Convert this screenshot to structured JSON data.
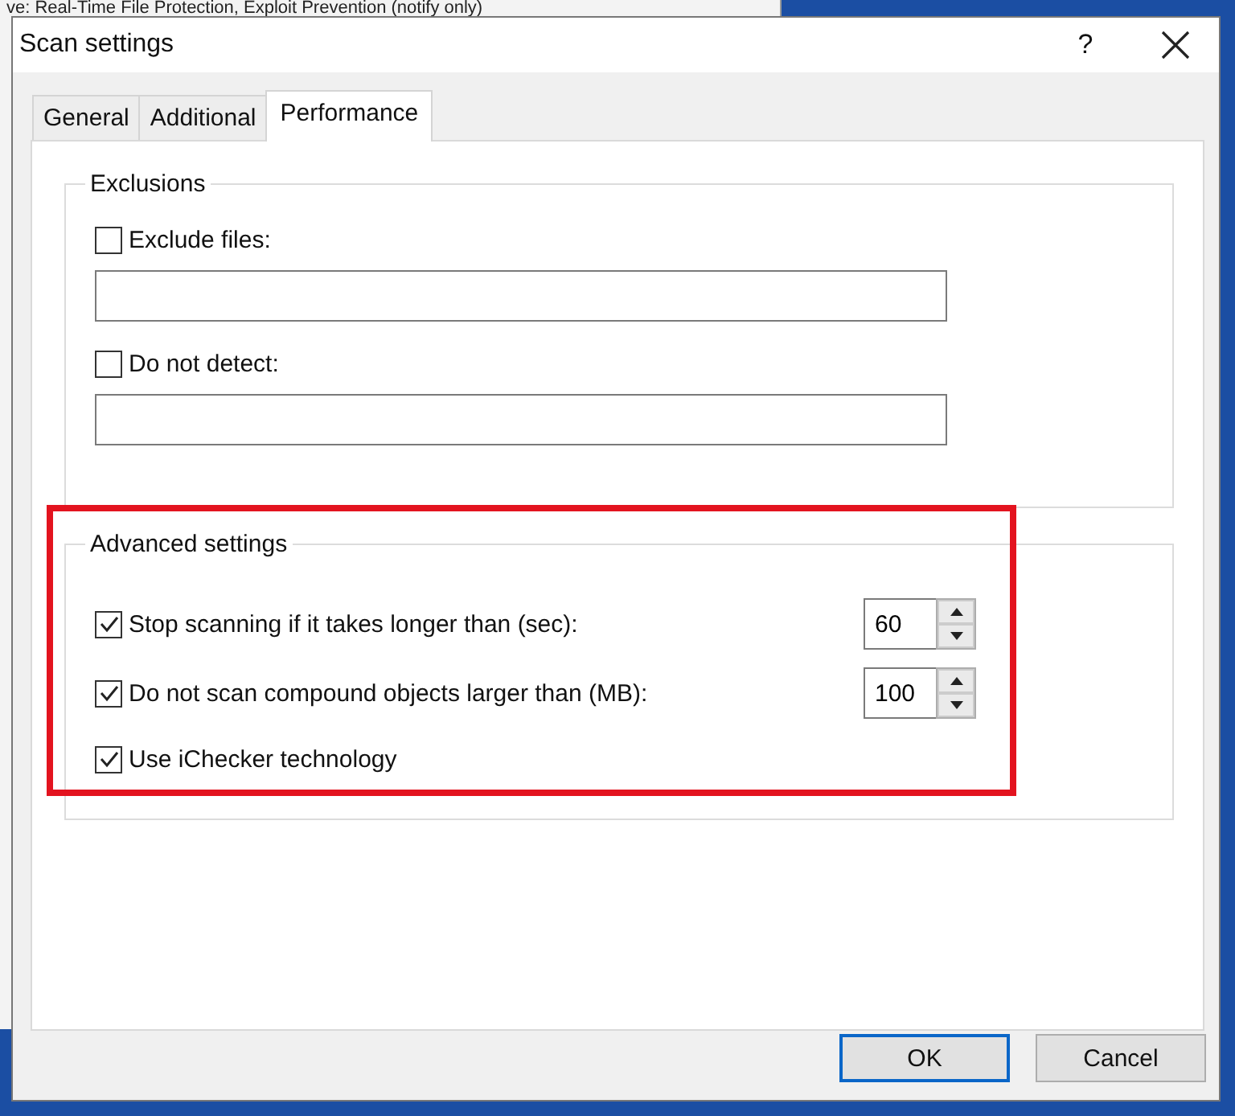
{
  "background_window": {
    "text": "ve: Real-Time File Protection, Exploit Prevention (notify only)"
  },
  "window": {
    "title": "Scan settings",
    "help": "?"
  },
  "tabs": [
    {
      "label": "General",
      "selected": false
    },
    {
      "label": "Additional",
      "selected": false
    },
    {
      "label": "Performance",
      "selected": true
    }
  ],
  "exclusions": {
    "title": "Exclusions",
    "items": [
      {
        "label": "Exclude files:",
        "checked": false
      },
      {
        "label": "Do not detect:",
        "checked": false
      }
    ]
  },
  "advanced": {
    "title": "Advanced settings",
    "highlighted": true,
    "items": [
      {
        "kind": "spin",
        "label": "Stop scanning if it takes longer than (sec):",
        "checked": true,
        "value": "60"
      },
      {
        "kind": "spin",
        "label": "Do not scan compound objects larger than (MB):",
        "checked": true,
        "value": "100"
      },
      {
        "kind": "check",
        "label": "Use iChecker technology",
        "checked": true
      }
    ]
  },
  "buttons": [
    {
      "label": "OK",
      "default": true
    },
    {
      "label": "Cancel",
      "default": false
    }
  ]
}
